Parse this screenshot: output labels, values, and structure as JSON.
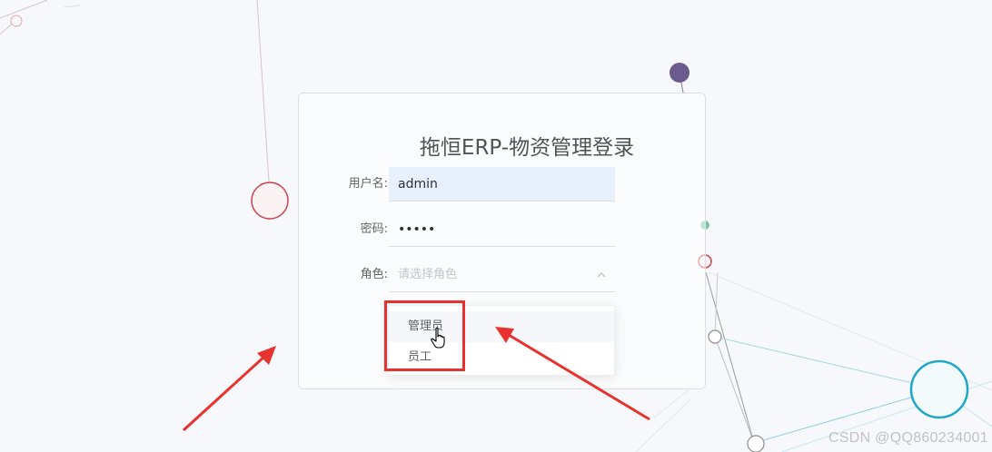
{
  "login": {
    "title": "拖恒ERP-物资管理登录",
    "username_label": "用户名:",
    "username_value": "admin",
    "password_label": "密码:",
    "password_value": "•••••",
    "role_label": "角色:",
    "role_placeholder": "请选择角色"
  },
  "role_dropdown": {
    "options": [
      "管理员",
      "员工"
    ],
    "hovered": "管理员"
  },
  "watermark": "CSDN @QQ860234001",
  "colors": {
    "annotation_red": "#e8322f",
    "autofill_bg": "#e8f0fe",
    "accent_cyan": "#1fa6c9",
    "node_purple": "#6b5a8e"
  },
  "icons": [
    "chevron-up-icon",
    "hand-pointer-icon",
    "arrow-annotation-icon"
  ]
}
